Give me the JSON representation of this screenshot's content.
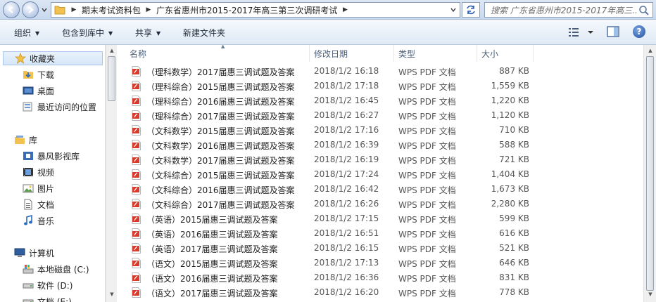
{
  "address": {
    "crumbs": [
      "期末考试资料包",
      "广东省惠州市2015-2017年高三第三次调研考试"
    ],
    "search_placeholder": "搜索 广东省惠州市2015-2017年高三..."
  },
  "toolbar": {
    "organize": "组织",
    "include_library": "包含到库中",
    "share": "共享",
    "new_folder": "新建文件夹",
    "help": "?"
  },
  "sidebar": {
    "favorites": "收藏夹",
    "downloads": "下载",
    "desktop": "桌面",
    "recent": "最近访问的位置",
    "libraries": "库",
    "storm_video": "暴风影视库",
    "videos": "视频",
    "pictures": "图片",
    "documents": "文档",
    "music": "音乐",
    "computer": "计算机",
    "drive_c": "本地磁盘 (C:)",
    "drive_d": "软件 (D:)",
    "drive_e": "文档 (E:)"
  },
  "columns": {
    "name": "名称",
    "modified": "修改日期",
    "type": "类型",
    "size": "大小"
  },
  "files": [
    {
      "name": "（理科数学）2017届惠三调试题及答案",
      "date": "2018/1/2 16:18",
      "type": "WPS PDF 文档",
      "size": "887 KB"
    },
    {
      "name": "（理科综合）2015届惠三调试题及答案",
      "date": "2018/1/2 17:18",
      "type": "WPS PDF 文档",
      "size": "1,559 KB"
    },
    {
      "name": "（理科综合）2016届惠三调试题及答案",
      "date": "2018/1/2 16:45",
      "type": "WPS PDF 文档",
      "size": "1,220 KB"
    },
    {
      "name": "（理科综合）2017届惠三调试题及答案",
      "date": "2018/1/2 16:27",
      "type": "WPS PDF 文档",
      "size": "1,120 KB"
    },
    {
      "name": "（文科数学）2015届惠三调试题及答案",
      "date": "2018/1/2 17:16",
      "type": "WPS PDF 文档",
      "size": "710 KB"
    },
    {
      "name": "（文科数学）2016届惠三调试题及答案",
      "date": "2018/1/2 16:39",
      "type": "WPS PDF 文档",
      "size": "588 KB"
    },
    {
      "name": "（文科数学）2017届惠三调试题及答案",
      "date": "2018/1/2 16:19",
      "type": "WPS PDF 文档",
      "size": "721 KB"
    },
    {
      "name": "（文科综合）2015届惠三调试题及答案",
      "date": "2018/1/2 17:24",
      "type": "WPS PDF 文档",
      "size": "1,404 KB"
    },
    {
      "name": "（文科综合）2016届惠三调试题及答案",
      "date": "2018/1/2 16:42",
      "type": "WPS PDF 文档",
      "size": "1,673 KB"
    },
    {
      "name": "（文科综合）2017届惠三调试题及答案",
      "date": "2018/1/2 16:26",
      "type": "WPS PDF 文档",
      "size": "2,280 KB"
    },
    {
      "name": "（英语）2015届惠三调试题及答案",
      "date": "2018/1/2 17:15",
      "type": "WPS PDF 文档",
      "size": "599 KB"
    },
    {
      "name": "（英语）2016届惠三调试题及答案",
      "date": "2018/1/2 16:51",
      "type": "WPS PDF 文档",
      "size": "616 KB"
    },
    {
      "name": "（英语）2017届惠三调试题及答案",
      "date": "2018/1/2 16:15",
      "type": "WPS PDF 文档",
      "size": "521 KB"
    },
    {
      "name": "（语文）2015届惠三调试题及答案",
      "date": "2018/1/2 17:13",
      "type": "WPS PDF 文档",
      "size": "646 KB"
    },
    {
      "name": "（语文）2016届惠三调试题及答案",
      "date": "2018/1/2 16:36",
      "type": "WPS PDF 文档",
      "size": "831 KB"
    },
    {
      "name": "（语文）2017届惠三调试题及答案",
      "date": "2018/1/2 16:20",
      "type": "WPS PDF 文档",
      "size": "778 KB"
    }
  ],
  "colors": {
    "pdf_red": "#d83b2b",
    "folder_yellow": "#f2c14e",
    "header_text": "#4c607a"
  }
}
